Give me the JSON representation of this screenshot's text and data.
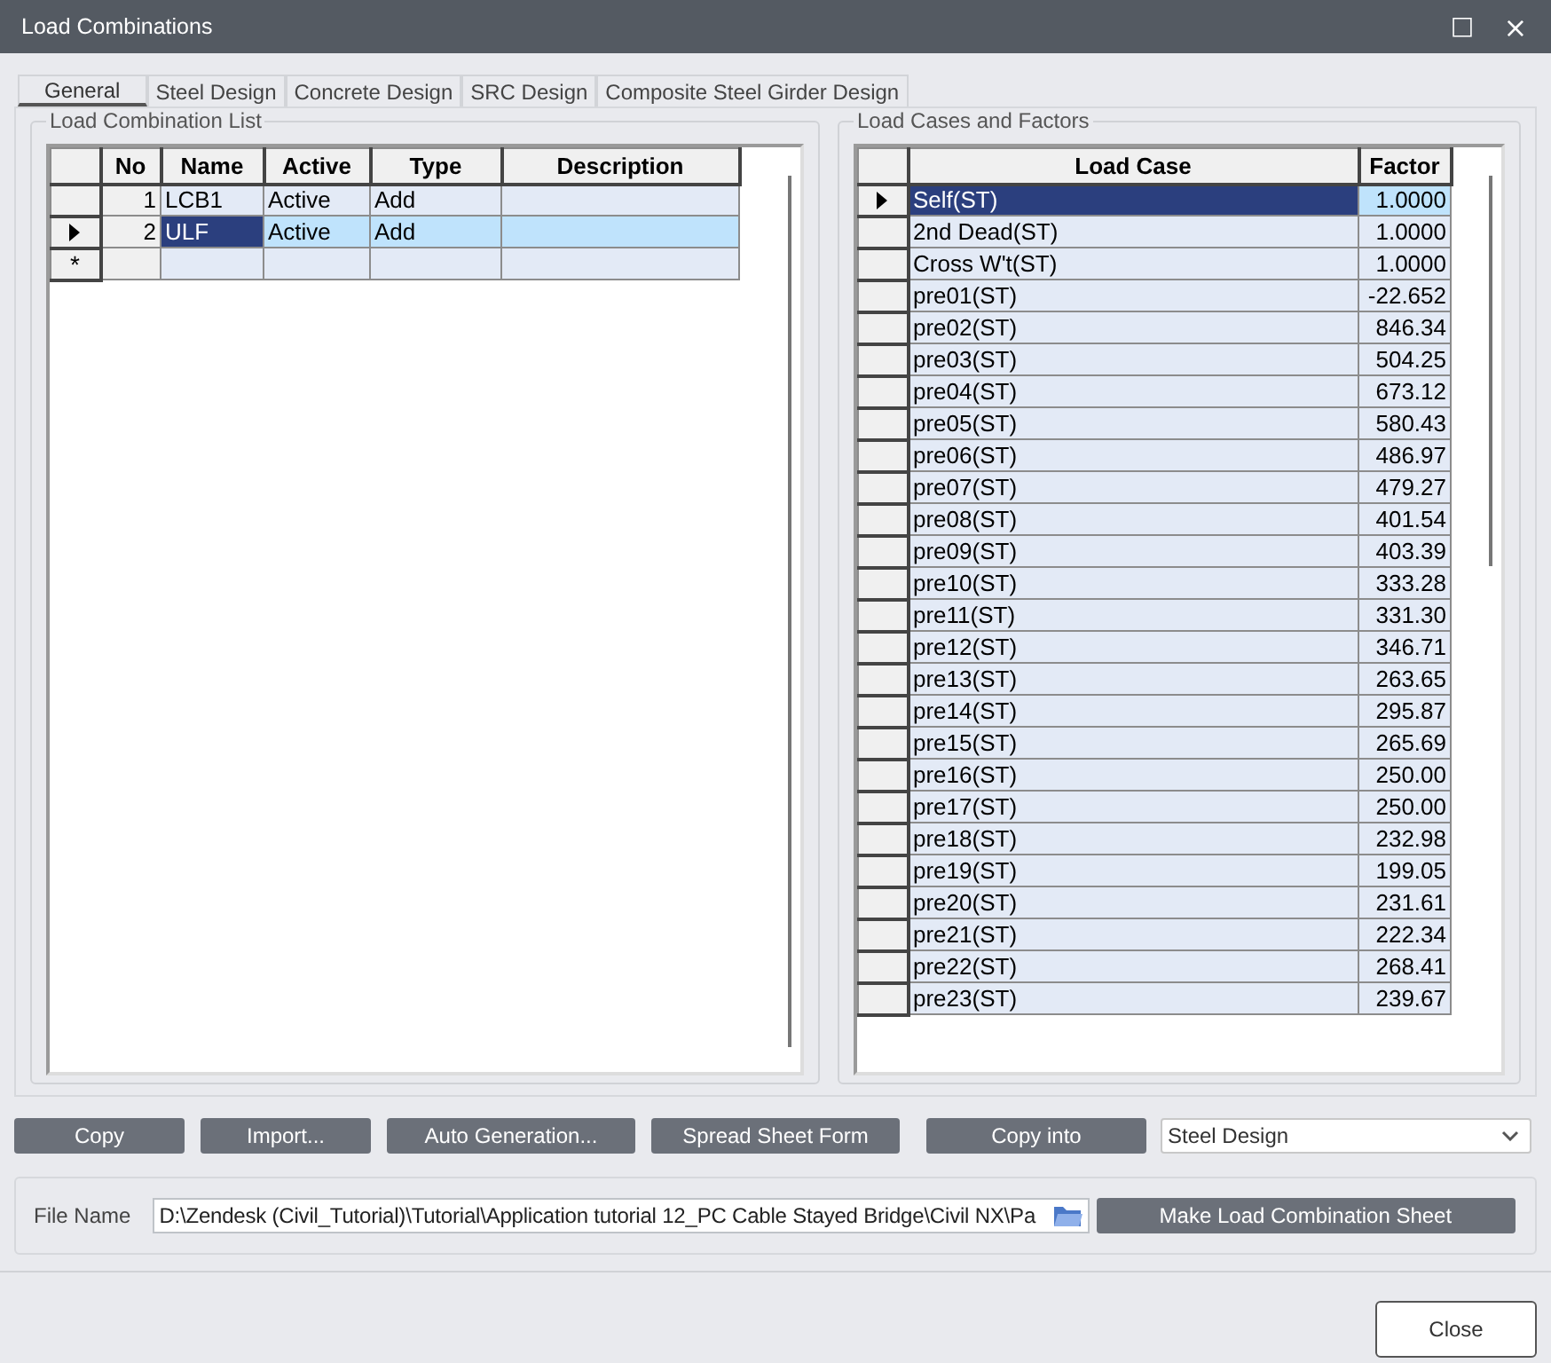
{
  "window": {
    "title": "Load Combinations",
    "buttons": [
      "□",
      "×"
    ]
  },
  "tabs": [
    {
      "label": "General",
      "selected": true
    },
    {
      "label": "Steel Design",
      "selected": false
    },
    {
      "label": "Concrete Design",
      "selected": false
    },
    {
      "label": "SRC Design",
      "selected": false
    },
    {
      "label": "Composite Steel Girder Design",
      "selected": false
    }
  ],
  "combination_list": {
    "title": "Load Combination List",
    "columns": [
      "No",
      "Name",
      "Active",
      "Type",
      "Description"
    ],
    "rows": [
      {
        "no": "1",
        "name": "LCB1",
        "active": "Active",
        "type": "Add",
        "description": "",
        "selected": false
      },
      {
        "no": "2",
        "name": "ULF",
        "active": "Active",
        "type": "Add",
        "description": "",
        "selected": true
      }
    ],
    "new_row_marker": "*"
  },
  "load_cases": {
    "title": "Load Cases and Factors",
    "columns": [
      "Load Case",
      "Factor"
    ],
    "rows": [
      {
        "load_case": "Self(ST)",
        "factor": "1.0000",
        "selected": true
      },
      {
        "load_case": "2nd Dead(ST)",
        "factor": "1.0000",
        "selected": false
      },
      {
        "load_case": "Cross W't(ST)",
        "factor": "1.0000",
        "selected": false
      },
      {
        "load_case": "pre01(ST)",
        "factor": "-22.652",
        "selected": false
      },
      {
        "load_case": "pre02(ST)",
        "factor": "846.34",
        "selected": false
      },
      {
        "load_case": "pre03(ST)",
        "factor": "504.25",
        "selected": false
      },
      {
        "load_case": "pre04(ST)",
        "factor": "673.12",
        "selected": false
      },
      {
        "load_case": "pre05(ST)",
        "factor": "580.43",
        "selected": false
      },
      {
        "load_case": "pre06(ST)",
        "factor": "486.97",
        "selected": false
      },
      {
        "load_case": "pre07(ST)",
        "factor": "479.27",
        "selected": false
      },
      {
        "load_case": "pre08(ST)",
        "factor": "401.54",
        "selected": false
      },
      {
        "load_case": "pre09(ST)",
        "factor": "403.39",
        "selected": false
      },
      {
        "load_case": "pre10(ST)",
        "factor": "333.28",
        "selected": false
      },
      {
        "load_case": "pre11(ST)",
        "factor": "331.30",
        "selected": false
      },
      {
        "load_case": "pre12(ST)",
        "factor": "346.71",
        "selected": false
      },
      {
        "load_case": "pre13(ST)",
        "factor": "263.65",
        "selected": false
      },
      {
        "load_case": "pre14(ST)",
        "factor": "295.87",
        "selected": false
      },
      {
        "load_case": "pre15(ST)",
        "factor": "265.69",
        "selected": false
      },
      {
        "load_case": "pre16(ST)",
        "factor": "250.00",
        "selected": false
      },
      {
        "load_case": "pre17(ST)",
        "factor": "250.00",
        "selected": false
      },
      {
        "load_case": "pre18(ST)",
        "factor": "232.98",
        "selected": false
      },
      {
        "load_case": "pre19(ST)",
        "factor": "199.05",
        "selected": false
      },
      {
        "load_case": "pre20(ST)",
        "factor": "231.61",
        "selected": false
      },
      {
        "load_case": "pre21(ST)",
        "factor": "222.34",
        "selected": false
      },
      {
        "load_case": "pre22(ST)",
        "factor": "268.41",
        "selected": false
      },
      {
        "load_case": "pre23(ST)",
        "factor": "239.67",
        "selected": false
      }
    ]
  },
  "actions": [
    "Copy",
    "Import...",
    "Auto Generation...",
    "Spread Sheet Form",
    "Copy into"
  ],
  "copy_target": {
    "value": "Steel Design"
  },
  "file_name": {
    "label": "File Name",
    "value": "D:\\Zendesk (Civil_Tutorial)\\Tutorial\\Application tutorial 12_PC Cable Stayed Bridge\\Civil NX\\Pa"
  },
  "make_sheet_button": "Make Load Combination Sheet",
  "close_button": "Close"
}
